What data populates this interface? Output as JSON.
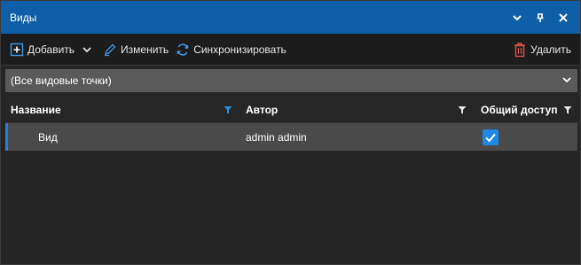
{
  "window": {
    "title": "Виды"
  },
  "toolbar": {
    "add_label": "Добавить",
    "edit_label": "Изменить",
    "sync_label": "Синхронизировать",
    "delete_label": "Удалить"
  },
  "filter": {
    "selected_value": "(Все видовые точки)"
  },
  "grid": {
    "columns": [
      "Название",
      "Автор",
      "Общий доступ"
    ],
    "rows": [
      {
        "name": "Вид",
        "author": "admin admin",
        "shared": true
      }
    ]
  },
  "colors": {
    "titlebar": "#0f5fa8",
    "accent": "#1e88e5",
    "delete_icon": "#d9534f"
  }
}
